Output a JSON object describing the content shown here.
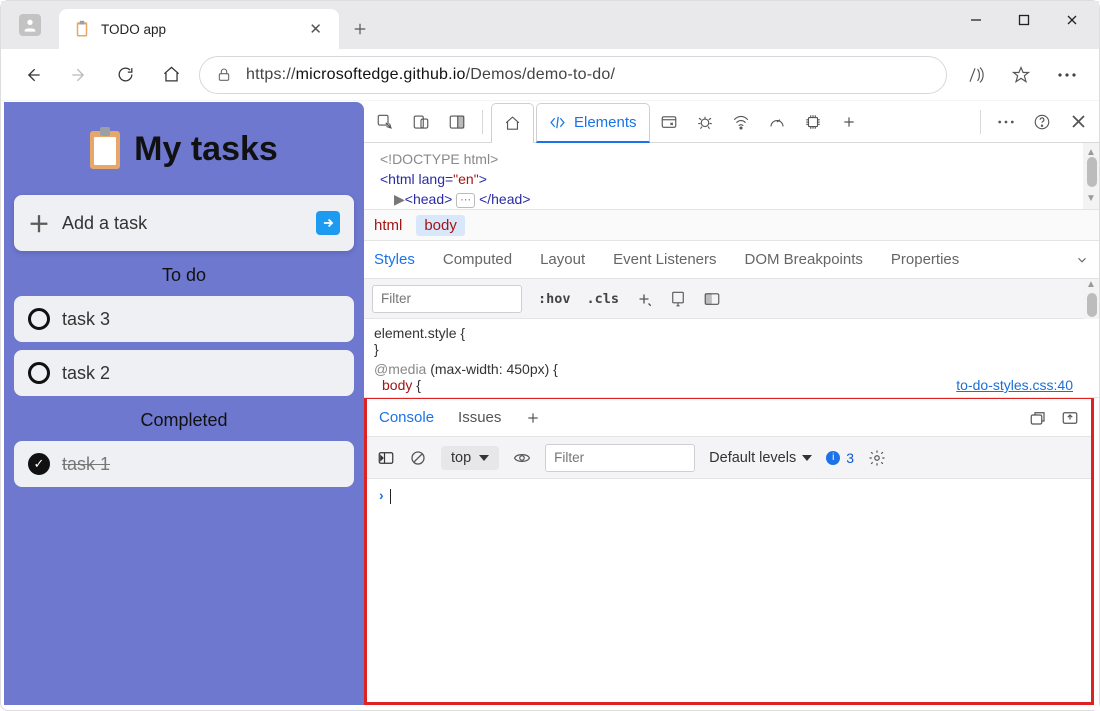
{
  "window": {
    "tab_title": "TODO app"
  },
  "nav": {
    "url_prefix": "https://",
    "url_host": "microsoftedge.github.io",
    "url_path": "/Demos/demo-to-do/"
  },
  "app": {
    "title": "My tasks",
    "add_label": "Add a task",
    "sections": {
      "todo": "To do",
      "completed": "Completed"
    },
    "todo": [
      {
        "label": "task 3"
      },
      {
        "label": "task 2"
      }
    ],
    "completed": [
      {
        "label": "task 1"
      }
    ]
  },
  "devtools": {
    "main_tab": "Elements",
    "dom": {
      "doctype": "<!DOCTYPE html>",
      "html_open_pre": "<html ",
      "html_attr": "lang",
      "html_eq": "=",
      "html_val": "\"en\"",
      "html_open_post": ">",
      "head_open": "<head>",
      "head_close": "</head>"
    },
    "breadcrumb": [
      "html",
      "body"
    ],
    "styles": {
      "tabs": [
        "Styles",
        "Computed",
        "Layout",
        "Event Listeners",
        "DOM Breakpoints",
        "Properties"
      ],
      "filter_ph": "Filter",
      "hov": ":hov",
      "cls": ".cls",
      "line1": "element.style {",
      "line2": "}",
      "media": "@media",
      "media_cond": " (max-width: 450px) {",
      "body_sel": "body",
      "body_open": " {",
      "link": "to-do-styles.css:40"
    },
    "drawer": {
      "tabs": [
        "Console",
        "Issues"
      ],
      "ctx": "top",
      "filter_ph": "Filter",
      "levels": "Default levels",
      "issues_count": "3"
    }
  }
}
